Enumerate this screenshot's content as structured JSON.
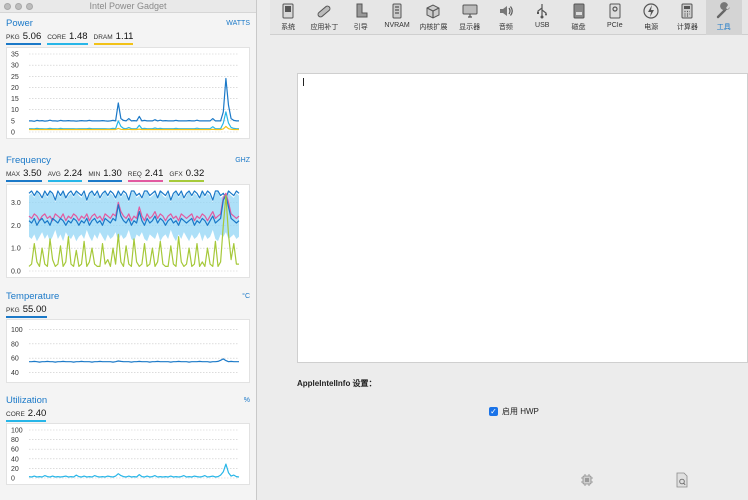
{
  "power_gadget": {
    "title": "Intel Power Gadget",
    "power": {
      "name": "Power",
      "unit": "WATTS",
      "stats": [
        {
          "label": "PKG",
          "value": "5.06",
          "color": "#1b79c8"
        },
        {
          "label": "CORE",
          "value": "1.48",
          "color": "#28b6e8"
        },
        {
          "label": "DRAM",
          "value": "1.11",
          "color": "#f2c218"
        }
      ]
    },
    "frequency": {
      "name": "Frequency",
      "unit": "GHZ",
      "stats": [
        {
          "label": "MAX",
          "value": "3.50",
          "color": "#1b79c8"
        },
        {
          "label": "AVG",
          "value": "2.24",
          "color": "#28b6e8"
        },
        {
          "label": "MIN",
          "value": "1.30",
          "color": "#1b79c8"
        },
        {
          "label": "REQ",
          "value": "2.41",
          "color": "#e25aa0"
        },
        {
          "label": "GFX",
          "value": "0.32",
          "color": "#a6c93a"
        }
      ]
    },
    "temperature": {
      "name": "Temperature",
      "unit": "°C",
      "stats": [
        {
          "label": "PKG",
          "value": "55.00",
          "color": "#1b79c8"
        }
      ]
    },
    "utilization": {
      "name": "Utilization",
      "unit": "%",
      "stats": [
        {
          "label": "CORE",
          "value": "2.40",
          "color": "#28b6e8"
        }
      ]
    }
  },
  "chart_data": [
    {
      "type": "line",
      "ylim": [
        0,
        35
      ],
      "yticks": [
        "35",
        "30",
        "25",
        "20",
        "15",
        "10",
        "5",
        "0"
      ],
      "series": [
        {
          "color": "#1b79c8",
          "values": [
            5,
            5,
            4.8,
            5.2,
            5,
            5.1,
            4.9,
            5,
            5.3,
            5,
            5,
            4.9,
            5.2,
            5,
            5,
            5.1,
            5,
            5,
            4.9,
            5,
            5.1,
            5,
            5,
            5.2,
            5,
            5,
            5,
            5,
            5.1,
            5,
            4.9,
            5,
            5.2,
            5,
            13,
            6,
            5.2,
            5,
            6,
            5,
            5.1,
            5,
            7,
            5,
            5.2,
            5,
            5,
            5,
            5.5,
            5,
            5.3,
            5,
            5.1,
            5,
            5,
            5,
            5.2,
            5,
            5,
            5,
            5,
            5.1,
            5,
            5,
            5.3,
            5,
            5,
            5,
            5,
            5,
            6,
            5,
            5,
            5,
            9,
            24,
            12,
            6,
            5.2,
            5,
            5
          ]
        },
        {
          "color": "#28b6e8",
          "values": [
            1.5,
            1.5,
            1.4,
            1.6,
            1.5,
            1.5,
            1.4,
            1.5,
            1.6,
            1.5,
            1.5,
            1.4,
            1.6,
            1.5,
            1.5,
            1.5,
            1.5,
            1.5,
            1.4,
            1.5,
            1.5,
            1.5,
            1.5,
            1.6,
            1.5,
            1.5,
            1.5,
            1.5,
            1.5,
            1.5,
            1.4,
            1.5,
            1.6,
            1.5,
            5,
            2.5,
            1.6,
            1.5,
            2,
            1.5,
            1.5,
            1.5,
            3,
            1.5,
            1.6,
            1.5,
            1.5,
            1.5,
            1.8,
            1.5,
            1.6,
            1.5,
            1.5,
            1.5,
            1.5,
            1.5,
            1.6,
            1.5,
            1.5,
            1.5,
            1.5,
            1.5,
            1.5,
            1.5,
            1.7,
            1.5,
            1.5,
            1.5,
            1.5,
            1.5,
            2.4,
            1.5,
            1.5,
            1.5,
            4,
            9,
            4,
            2,
            1.6,
            1.5,
            1.5
          ]
        },
        {
          "color": "#f2c218",
          "values": [
            1.1,
            1.1,
            1.1,
            1.1,
            1.1,
            1.1,
            1.1,
            1.1,
            1.1,
            1.1,
            1.1,
            1.1,
            1.1,
            1.1,
            1.1,
            1.1,
            1.1,
            1.1,
            1.1,
            1.1,
            1.1,
            1.1,
            1.1,
            1.1,
            1.1,
            1.1,
            1.1,
            1.1,
            1.1,
            1.1,
            1.1,
            1.1,
            1.1,
            1.1,
            1.6,
            1.2,
            1.1,
            1.1,
            1.2,
            1.1,
            1.1,
            1.1,
            1.3,
            1.1,
            1.1,
            1.1,
            1.1,
            1.1,
            1.1,
            1.1,
            1.1,
            1.1,
            1.1,
            1.1,
            1.1,
            1.1,
            1.1,
            1.1,
            1.1,
            1.1,
            1.1,
            1.1,
            1.1,
            1.1,
            1.1,
            1.1,
            1.1,
            1.1,
            1.1,
            1.1,
            1.2,
            1.1,
            1.1,
            1.1,
            1.4,
            2.5,
            1.5,
            1.2,
            1.1,
            1.1,
            1.1
          ]
        }
      ]
    },
    {
      "type": "area",
      "ylim": [
        0,
        3.5
      ],
      "yticks": [
        "3.0",
        "2.0",
        "1.0",
        "0.0"
      ],
      "band": {
        "color": "#93d5f5",
        "upper": [
          3.3,
          3.4,
          3.2,
          3.5,
          3.3,
          3.1,
          3.4,
          3.2,
          3.5,
          3.3,
          3.0,
          3.4,
          3.2,
          3.5,
          3.1,
          3.3,
          3.4,
          3.2,
          3.5,
          3.3,
          3.2,
          3.4,
          3.0,
          3.3,
          3.5,
          3.2,
          3.4,
          3.1,
          3.3,
          3.5,
          3.2,
          3.4,
          3.3,
          3.1,
          3.5,
          3.2,
          3.4,
          3.3,
          3.0,
          3.4,
          3.5,
          3.2,
          3.3,
          3.1,
          3.4,
          3.5,
          3.2,
          3.3,
          3.4,
          3.1,
          3.5,
          3.3,
          3.2,
          3.4,
          3.0,
          3.3,
          3.5,
          3.2,
          3.4,
          3.1,
          3.3,
          3.5,
          3.2,
          3.4,
          3.3,
          3.1,
          3.5,
          3.2,
          3.4,
          3.3,
          3.0,
          3.4,
          3.5,
          3.2,
          3.3,
          3.1,
          3.4,
          3.3,
          3.2,
          3.4,
          3.3
        ],
        "lower": [
          1.5,
          1.4,
          1.6,
          1.3,
          1.5,
          1.7,
          1.4,
          1.6,
          1.3,
          1.5,
          1.8,
          1.4,
          1.6,
          1.3,
          1.7,
          1.5,
          1.4,
          1.6,
          1.3,
          1.5,
          1.6,
          1.4,
          1.8,
          1.5,
          1.3,
          1.6,
          1.4,
          1.7,
          1.5,
          1.3,
          1.6,
          1.4,
          1.5,
          1.7,
          1.3,
          1.6,
          1.4,
          1.5,
          1.8,
          1.4,
          1.3,
          1.6,
          1.5,
          1.7,
          1.4,
          1.3,
          1.6,
          1.5,
          1.4,
          1.7,
          1.3,
          1.5,
          1.6,
          1.4,
          1.8,
          1.5,
          1.3,
          1.6,
          1.4,
          1.7,
          1.5,
          1.3,
          1.6,
          1.4,
          1.5,
          1.7,
          1.3,
          1.6,
          1.4,
          1.5,
          1.8,
          1.4,
          1.3,
          1.6,
          1.5,
          1.7,
          1.4,
          1.5,
          1.6,
          1.4,
          1.5
        ]
      },
      "series": [
        {
          "color": "#1b79c8",
          "values": [
            3.4,
            3.5,
            3.3,
            3.5,
            3.4,
            3.2,
            3.5,
            3.3,
            3.5,
            3.4,
            3.1,
            3.5,
            3.3,
            3.5,
            3.2,
            3.4,
            3.5,
            3.3,
            3.5,
            3.4,
            3.3,
            3.5,
            3.1,
            3.4,
            3.5,
            3.3,
            3.5,
            3.2,
            3.4,
            3.5,
            3.3,
            3.5,
            3.4,
            3.2,
            3.5,
            3.3,
            3.5,
            3.4,
            3.1,
            3.5,
            3.5,
            3.3,
            3.4,
            3.2,
            3.5,
            3.5,
            3.3,
            3.4,
            3.5,
            3.2,
            3.5,
            3.4,
            3.3,
            3.5,
            3.1,
            3.4,
            3.5,
            3.3,
            3.5,
            3.2,
            3.4,
            3.5,
            3.3,
            3.5,
            3.4,
            3.2,
            3.5,
            3.3,
            3.5,
            3.4,
            3.1,
            3.5,
            3.5,
            3.3,
            3.4,
            3.2,
            3.5,
            3.4,
            3.3,
            3.5,
            3.4
          ]
        },
        {
          "color": "#e25aa0",
          "values": [
            2.4,
            2.3,
            2.5,
            2.4,
            2.2,
            2.4,
            2.5,
            2.3,
            2.4,
            2.2,
            2.5,
            2.4,
            2.3,
            2.5,
            2.2,
            2.4,
            2.3,
            2.5,
            2.4,
            2.2,
            2.4,
            2.3,
            2.5,
            2.2,
            2.4,
            2.5,
            2.3,
            2.4,
            2.2,
            2.5,
            2.4,
            2.3,
            2.5,
            2.4,
            3.0,
            2.6,
            2.4,
            2.3,
            2.5,
            2.2,
            2.4,
            2.3,
            2.8,
            2.4,
            2.2,
            2.5,
            2.3,
            2.4,
            2.6,
            2.3,
            2.5,
            2.4,
            2.2,
            2.4,
            2.5,
            2.3,
            2.4,
            2.2,
            2.5,
            2.4,
            2.3,
            2.4,
            2.5,
            2.2,
            2.4,
            2.3,
            2.5,
            2.4,
            2.2,
            2.4,
            2.6,
            2.3,
            2.4,
            2.5,
            3.2,
            3.4,
            3.0,
            2.5,
            2.4,
            2.3,
            2.4
          ]
        },
        {
          "color": "#1b79c8",
          "values": [
            2.2,
            2.1,
            2.3,
            2.0,
            2.2,
            2.3,
            2.1,
            2.2,
            2.0,
            2.3,
            2.2,
            2.1,
            2.3,
            2.2,
            2.0,
            2.2,
            2.1,
            2.3,
            2.2,
            2.0,
            2.2,
            2.1,
            2.3,
            2.0,
            2.2,
            2.3,
            2.1,
            2.2,
            2.0,
            2.3,
            2.2,
            2.1,
            2.3,
            2.2,
            2.9,
            2.4,
            2.2,
            2.1,
            2.3,
            2.0,
            2.2,
            2.1,
            2.6,
            2.2,
            2.0,
            2.3,
            2.1,
            2.2,
            2.4,
            2.1,
            2.3,
            2.2,
            2.0,
            2.2,
            2.3,
            2.1,
            2.2,
            2.0,
            2.3,
            2.2,
            2.1,
            2.2,
            2.3,
            2.0,
            2.2,
            2.1,
            2.3,
            2.2,
            2.0,
            2.2,
            2.4,
            2.1,
            2.2,
            2.3,
            3.1,
            3.3,
            2.8,
            2.3,
            2.2,
            2.1,
            2.2
          ]
        },
        {
          "color": "#a6c93a",
          "values": [
            0.2,
            0.3,
            1.2,
            0.4,
            0.2,
            1.0,
            0.3,
            0.2,
            1.4,
            0.5,
            0.2,
            0.3,
            1.1,
            0.2,
            0.4,
            1.5,
            0.3,
            0.2,
            0.9,
            0.2,
            0.3,
            1.3,
            0.2,
            0.4,
            1.0,
            0.3,
            0.2,
            0.2,
            1.2,
            0.3,
            0.5,
            0.2,
            1.0,
            0.3,
            1.6,
            0.4,
            0.2,
            1.1,
            0.3,
            0.2,
            1.4,
            0.4,
            0.2,
            0.3,
            1.2,
            0.2,
            0.3,
            1.0,
            0.2,
            0.4,
            1.3,
            0.3,
            0.2,
            0.2,
            1.1,
            0.3,
            0.2,
            1.5,
            0.4,
            0.2,
            0.3,
            1.0,
            0.2,
            0.3,
            1.2,
            0.2,
            0.4,
            0.2,
            1.0,
            0.3,
            0.2,
            1.3,
            0.2,
            0.4,
            2.0,
            3.3,
            1.6,
            0.5,
            1.2,
            0.3,
            0.3
          ]
        }
      ]
    },
    {
      "type": "line",
      "ylim": [
        35,
        105
      ],
      "yticks": [
        "100",
        "80",
        "60",
        "40"
      ],
      "series": [
        {
          "color": "#1b79c8",
          "values": [
            55,
            55,
            55.5,
            55,
            54.5,
            55,
            55,
            55.5,
            55,
            55,
            54.5,
            55,
            55,
            55.5,
            55,
            55,
            55,
            54.5,
            55,
            55,
            55.5,
            55,
            55,
            55,
            54.5,
            55,
            55,
            55.5,
            55,
            55,
            55,
            55,
            54.5,
            55,
            56,
            55.5,
            55,
            55,
            55,
            54.5,
            55,
            55,
            55.5,
            55,
            55,
            55,
            54.5,
            55,
            55,
            55.5,
            55,
            55,
            55,
            55,
            54.5,
            55,
            55,
            55.5,
            55,
            55,
            55,
            54.5,
            55,
            55,
            55,
            55.5,
            55,
            55,
            55,
            54.5,
            55,
            55,
            55.5,
            57,
            59,
            56.5,
            55,
            55.5,
            55,
            55,
            55
          ]
        }
      ]
    },
    {
      "type": "line",
      "ylim": [
        0,
        100
      ],
      "yticks": [
        "100",
        "80",
        "60",
        "40",
        "20",
        "0"
      ],
      "series": [
        {
          "color": "#28b6e8",
          "values": [
            3,
            2,
            4,
            2,
            3,
            2,
            5,
            3,
            2,
            4,
            2,
            3,
            2,
            3,
            4,
            2,
            3,
            2,
            6,
            3,
            2,
            4,
            2,
            3,
            2,
            5,
            3,
            2,
            3,
            2,
            4,
            3,
            2,
            4,
            9,
            5,
            3,
            2,
            4,
            2,
            3,
            2,
            7,
            3,
            2,
            4,
            2,
            3,
            5,
            2,
            3,
            2,
            3,
            2,
            4,
            2,
            3,
            2,
            3,
            5,
            2,
            3,
            2,
            4,
            3,
            2,
            3,
            5,
            2,
            3,
            4,
            2,
            3,
            6,
            13,
            29,
            11,
            4,
            6,
            3,
            2
          ]
        }
      ]
    }
  ],
  "hackintool": {
    "toolbar": [
      {
        "label": "系统",
        "icon": "computer-icon"
      },
      {
        "label": "应用补丁",
        "icon": "patch-bandage-icon"
      },
      {
        "label": "引导",
        "icon": "boot-icon"
      },
      {
        "label": "NVRAM",
        "icon": "nvram-chip-icon"
      },
      {
        "label": "内核扩展",
        "icon": "kernel-extension-icon"
      },
      {
        "label": "显示器",
        "icon": "display-icon"
      },
      {
        "label": "音频",
        "icon": "speaker-icon"
      },
      {
        "label": "USB",
        "icon": "usb-icon"
      },
      {
        "label": "磁盘",
        "icon": "disk-icon"
      },
      {
        "label": "PCIe",
        "icon": "pcie-card-icon"
      },
      {
        "label": "电源",
        "icon": "power-bolt-icon"
      },
      {
        "label": "计算器",
        "icon": "calculator-icon"
      },
      {
        "label": "工具",
        "icon": "wrench-icon"
      }
    ],
    "active_tool": "工具",
    "settings_label": "AppleIntelInfo 设置：",
    "hwp_checkbox": {
      "label": "启用 HWP",
      "checked": true
    }
  }
}
